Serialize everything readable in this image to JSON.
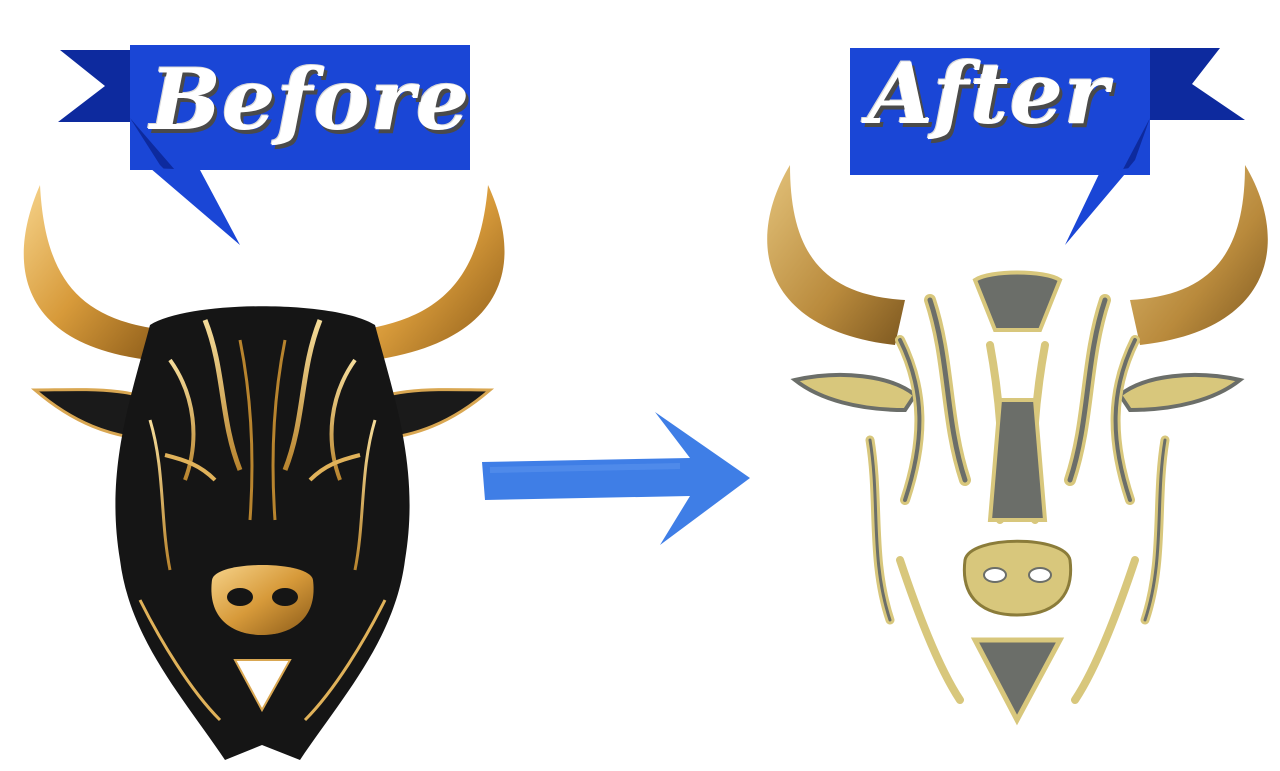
{
  "labels": {
    "before": "Before",
    "after": "After"
  },
  "colors": {
    "banner_blue": "#1a46d6",
    "banner_dark": "#0d2a9e",
    "arrow_blue": "#2f73e4",
    "gold": "#e0b25a",
    "gold_dark": "#9a6a22",
    "black": "#151515",
    "thread_gray": "#6b6e69",
    "thread_gold": "#d8c77c"
  },
  "icons": {
    "left_image": "black-and-gold-bull-head-icon",
    "right_image": "embroidered-bull-head-icon",
    "arrow": "right-arrow-icon"
  }
}
